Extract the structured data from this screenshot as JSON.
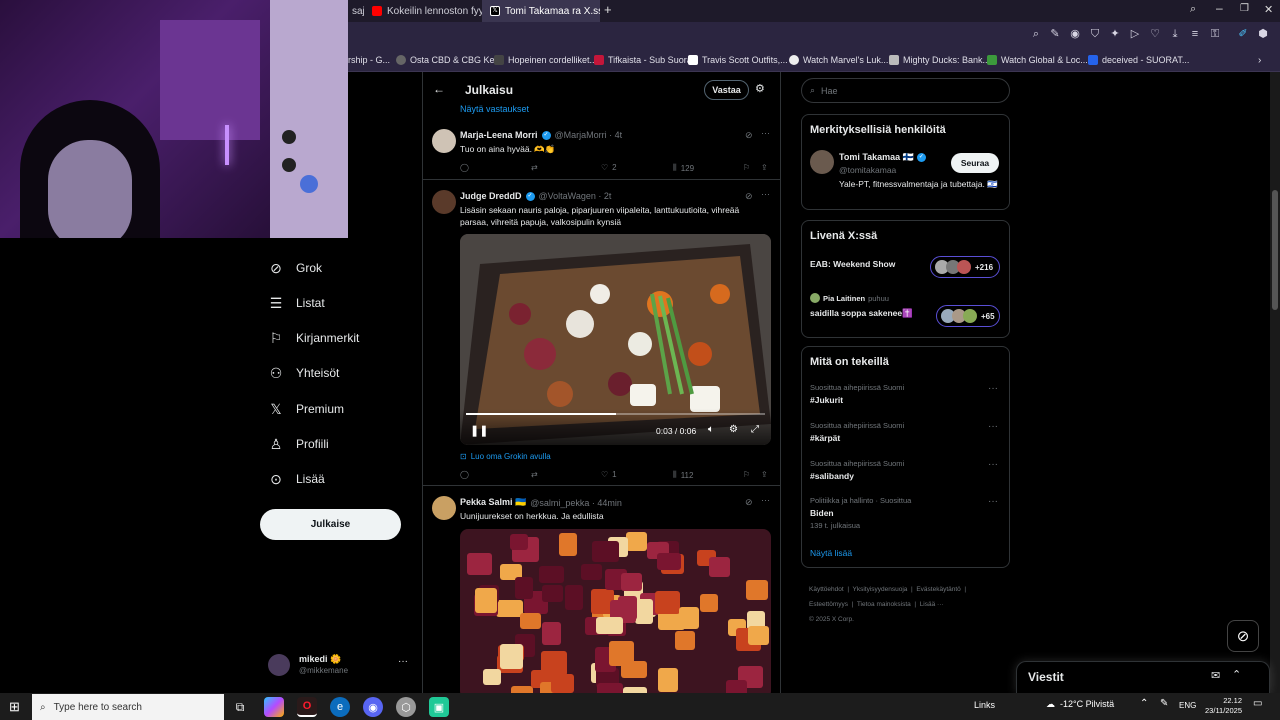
{
  "browser": {
    "tabs": [
      {
        "label": "sajc"
      },
      {
        "label": "Kokeilin lennoston fyysise"
      },
      {
        "label": "Tomi Takamaa ra X.ssa"
      }
    ],
    "bookmarks": [
      "rship - G...",
      "Osta CBD & CBG Ke...",
      "Hopeinen cordelliket...",
      "Tifkaista - Sub Suora",
      "Travis Scott Outfits,...",
      "Watch Marvel's Luk...",
      "Mighty Ducks: Bank...",
      "Watch Global & Loc...",
      "deceived - SUORAT..."
    ]
  },
  "nav": {
    "partial_item": "ohdan",
    "partial_label": "et",
    "items": [
      {
        "label": "Grok",
        "icon": "grok-icon"
      },
      {
        "label": "Listat",
        "icon": "lists-icon"
      },
      {
        "label": "Kirjanmerkit",
        "icon": "bookmark-icon"
      },
      {
        "label": "Yhteisöt",
        "icon": "communities-icon"
      },
      {
        "label": "Premium",
        "icon": "x-logo-icon"
      },
      {
        "label": "Profiili",
        "icon": "profile-icon"
      },
      {
        "label": "Lisää",
        "icon": "more-icon"
      }
    ],
    "post_button": "Julkaise",
    "account": {
      "name": "mikedi",
      "handle": "@mikkemane"
    }
  },
  "header": {
    "title": "Julkaisu",
    "reply_button": "Vastaa",
    "show_replies": "Näytä vastaukset"
  },
  "tweets": [
    {
      "name": "Marja-Leena Morri",
      "handle": "@MarjaMorri · 4t",
      "text": "Tuo on aina hyvää. 🫶👏",
      "replies": "",
      "retweets": "",
      "likes": "2",
      "views": "129"
    },
    {
      "name": "Judge DreddD",
      "handle": "@VoltaWagen · 2t",
      "text": "Lisäsin sekaan nauris paloja, piparjuuren viipaleita, lanttukuutioita, vihreää parsaa, vihreitä papuja, valkosipulin kynsiä",
      "video_time": "0:03 / 0:06",
      "grok_link": "Luo oma Grokin avulla",
      "replies": "",
      "retweets": "",
      "likes": "1",
      "views": "112"
    },
    {
      "name": "Pekka Salmi 🇺🇦",
      "handle": "@salmi_pekka · 44min",
      "text": "Uunijuurekset on herkkua. Ja edullista"
    }
  ],
  "right": {
    "search_placeholder": "Hae",
    "relevant_title": "Merkityksellisiä henkilöitä",
    "person": {
      "name": "Tomi Takamaa 🇫🇮",
      "handle": "@tomitakamaa",
      "bio": "Yale-PT, fitnessvalmentaja ja tubettaja. 🇮🇱",
      "follow": "Seuraa"
    },
    "live_title": "Livenä X:ssä",
    "live": [
      {
        "host": "",
        "title": "EAB: Weekend Show",
        "count": "+216"
      },
      {
        "host": "Pia Laitinen",
        "speaking": "puhuu",
        "title": "saidilla soppa sakenee✝️",
        "count": "+65"
      }
    ],
    "trends_title": "Mitä on tekeillä",
    "trends": [
      {
        "context": "Suosittua aihepiirissä Suomi",
        "tag": "#Jukurit",
        "posts": ""
      },
      {
        "context": "Suosittua aihepiirissä Suomi",
        "tag": "#kärpät",
        "posts": ""
      },
      {
        "context": "Suosittua aihepiirissä Suomi",
        "tag": "#salibandy",
        "posts": ""
      },
      {
        "context": "Politiikka ja hallinto · Suosittua",
        "tag": "Biden",
        "posts": "139 t. julkaisua"
      }
    ],
    "show_more": "Näytä lisää",
    "footer": [
      "Käyttöehdot",
      "Yksityisyydensuoja",
      "Evästekäytäntö",
      "Esteettömyys",
      "Tietoa mainoksista",
      "Lisää ···",
      "© 2025 X Corp."
    ]
  },
  "messages": {
    "title": "Viestit"
  },
  "taskbar": {
    "search_placeholder": "Type here to search",
    "links": "Links",
    "weather": "-12°C  Pilvistä",
    "lang": "ENG",
    "time": "22.12",
    "date": "23/11/2025"
  }
}
